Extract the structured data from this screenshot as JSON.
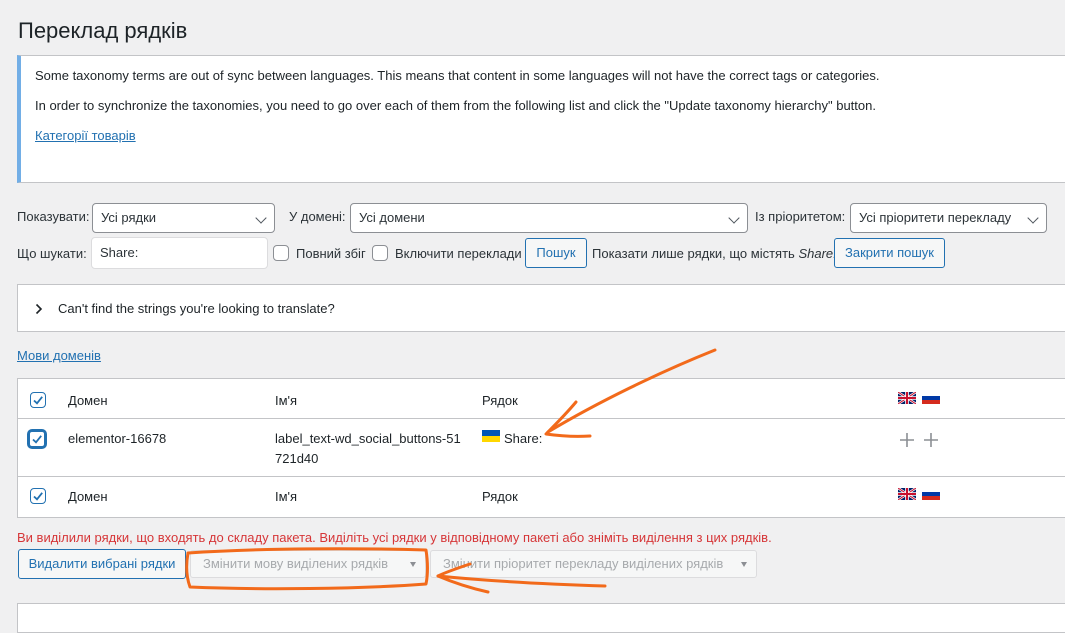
{
  "page": {
    "title": "Переклад рядків"
  },
  "notice": {
    "line1": "Some taxonomy terms are out of sync between languages. This means that content in some languages will not have the correct tags or categories.",
    "line2": "In order to synchronize the taxonomies, you need to go over each of them from the following list and click the \"Update taxonomy hierarchy\" button.",
    "link": "Категорії товарів"
  },
  "filters": {
    "show_label": "Показувати:",
    "show_value": "Усі рядки",
    "domain_label": "У домені:",
    "domain_value": "Усі домени",
    "priority_label": "Із пріоритетом:",
    "priority_value": "Усі пріоритети перекладу",
    "search_label": "Що шукати:",
    "search_value": "Share:",
    "exact_match_label": "Повний збіг",
    "include_translations_label": "Включити переклади",
    "search_button": "Пошук",
    "showing_prefix": "Показати лише рядки, що містять",
    "showing_term": "Share:",
    "close_search_button": "Закрити пошук"
  },
  "accordion": {
    "label": "Can't find the strings you're looking to translate?"
  },
  "domain_languages_link": "Мови доменів",
  "table": {
    "headers": {
      "domain": "Домен",
      "name": "Ім'я",
      "string": "Рядок"
    },
    "rows": [
      {
        "domain": "elementor-16678",
        "name_line1": "label_text-wd_social_buttons-51",
        "name_line2": "721d40",
        "string": "Share:"
      }
    ]
  },
  "bulk": {
    "error": "Ви виділили рядки, що входять до складу пакета. Виділіть усі рядки у відповідному пакеті або зніміть виділення з цих рядків.",
    "delete_button": "Видалити вибрані рядки",
    "change_language": "Змінити мову виділених рядків",
    "change_priority": "Змінити пріоритет перекладу виділених рядків"
  },
  "colors": {
    "accent": "#2271b1",
    "error": "#d63638",
    "annotation": "#f26a1b",
    "notice_border": "#72aee6"
  }
}
